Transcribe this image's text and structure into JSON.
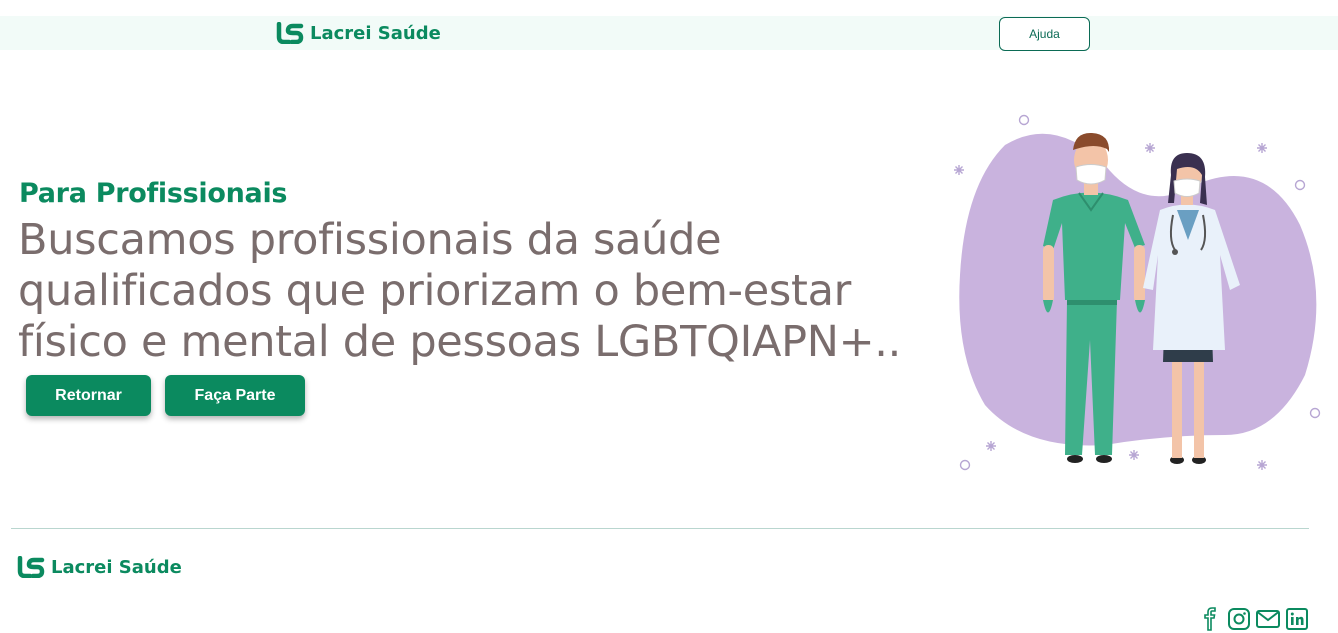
{
  "header": {
    "brand": "Lacrei Saúde",
    "help_label": "Ajuda"
  },
  "hero": {
    "kicker": "Para Profissionais",
    "headline": "Buscamos profissionais da saúde qualificados que priorizam o bem-estar físico e mental de pessoas LGBTQIAPN+..",
    "back_label": "Retornar",
    "join_label": "Faça Parte"
  },
  "footer": {
    "brand": "Lacrei Saúde",
    "socials": [
      "facebook-icon",
      "instagram-icon",
      "mail-icon",
      "linkedin-icon"
    ]
  },
  "colors": {
    "brand_green": "#0b8a5f",
    "headline_gray": "#7a6d6d",
    "blob_purple": "#c9b3de",
    "scrubs_green": "#3fb08a"
  }
}
